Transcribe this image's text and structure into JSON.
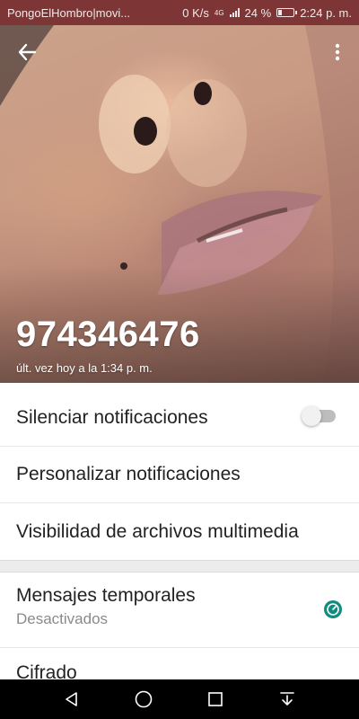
{
  "status_bar": {
    "notification_text": "PongoElHombro|movi...",
    "network_speed": "0 K/s",
    "network_type": "4G",
    "battery_percent_text": "24 %",
    "battery_level": 0.24,
    "time": "2:24 p. m."
  },
  "header": {
    "contact_name": "974346476",
    "last_seen": "últ. vez hoy a la 1:34 p. m.",
    "back_icon": "arrow-back-icon",
    "menu_icon": "more-vert-icon"
  },
  "settings": {
    "mute_label": "Silenciar notificaciones",
    "mute_enabled": false,
    "custom_notifications_label": "Personalizar notificaciones",
    "media_visibility_label": "Visibilidad de archivos multimedia",
    "disappearing_label": "Mensajes temporales",
    "disappearing_value": "Desactivados",
    "encryption_label": "Cifrado"
  },
  "colors": {
    "status_bar": "#7d3535",
    "accent": "#128c7e"
  },
  "nav_bar": {
    "back_icon": "triangle-back-icon",
    "home_icon": "circle-home-icon",
    "recents_icon": "square-recents-icon",
    "notifications_icon": "pull-down-icon"
  }
}
